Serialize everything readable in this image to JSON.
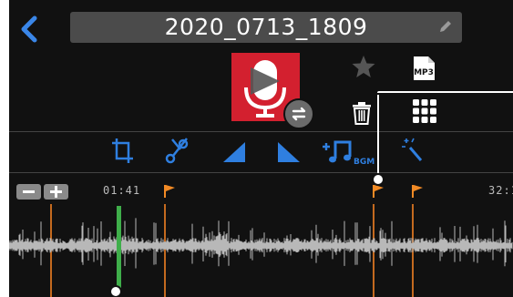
{
  "header": {
    "title": "2020_0713_1809",
    "back_icon": "chevron-left-icon",
    "edit_icon": "pencil-icon"
  },
  "actions": {
    "album_art_icon": "microphone-play-icon",
    "swap_icon": "swap-arrows-icon",
    "favorite_icon": "star-icon",
    "format_badge": "MP3",
    "delete_icon": "trash-icon",
    "grid_icon": "grid-menu-icon"
  },
  "toolbar": {
    "tools": [
      "trim-icon",
      "cut-scissors-icon",
      "fade-in-icon",
      "fade-out-icon",
      "add-bgm-icon",
      "effect-wand-icon"
    ],
    "bgm_label": "BGM"
  },
  "timeline": {
    "zoom_out_label": "−",
    "zoom_in_label": "+",
    "current_time": "01:41",
    "end_time": "32:1",
    "marker_count": 4
  },
  "colors": {
    "accent_blue": "#2f7fe0",
    "marker_orange": "#f18a25",
    "playhead_green": "#3fae4a",
    "album_red": "#d3202f"
  }
}
